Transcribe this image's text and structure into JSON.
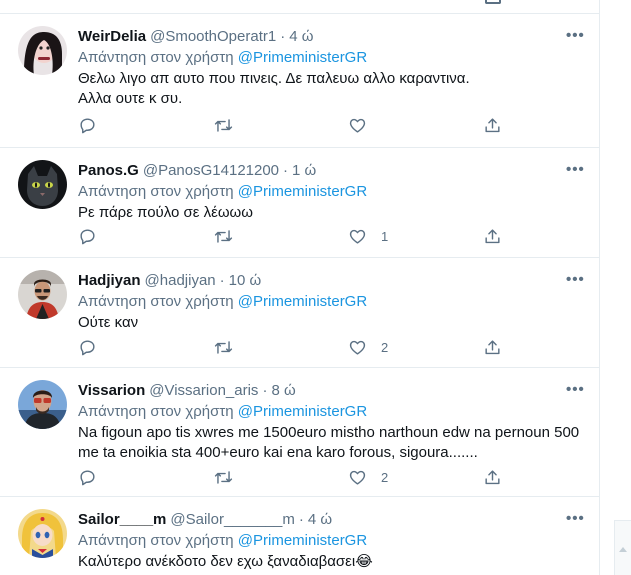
{
  "ui": {
    "reply_prefix": "Απάντηση στον χρήστη",
    "more_glyph": "•••",
    "dot": "·"
  },
  "tweets": [
    {
      "name": "WeirDelia",
      "handle": "@SmoothOperatr1",
      "time": "4 ώ",
      "reply_to": "@PrimeministerGR",
      "text_lines": [
        "Θελω λιγο απ αυτο που πινεις. Δε παλευω αλλο καραντινα.",
        "Αλλα ουτε κ συ."
      ],
      "likes": ""
    },
    {
      "name": "Panos.G",
      "handle": "@PanosG14121200",
      "time": "1 ώ",
      "reply_to": "@PrimeministerGR",
      "text_lines": [
        "Ρε πάρε πούλο σε λέωωω"
      ],
      "likes": "1"
    },
    {
      "name": "Hadjiyan",
      "handle": "@hadjiyan",
      "time": "10 ώ",
      "reply_to": "@PrimeministerGR",
      "text_lines": [
        "Ούτε καν"
      ],
      "likes": "2"
    },
    {
      "name": "Vissarion",
      "handle": "@Vissarion_aris",
      "time": "8 ώ",
      "reply_to": "@PrimeministerGR",
      "text_lines": [
        "Na figoun apo tis xwres me 1500euro mistho narthoun edw na pernoun 500",
        "me ta enoikia sta 400+euro kai ena karo forous, sigoura......."
      ],
      "likes": "2"
    },
    {
      "name": "Sailor____m",
      "handle": "@Sailor_______m",
      "time": "4 ώ",
      "reply_to": "@PrimeministerGR",
      "text_lines": [
        "Καλύτερο ανέκδοτο δεν εχω ξαναδιαβασει😂"
      ],
      "likes": ""
    }
  ]
}
